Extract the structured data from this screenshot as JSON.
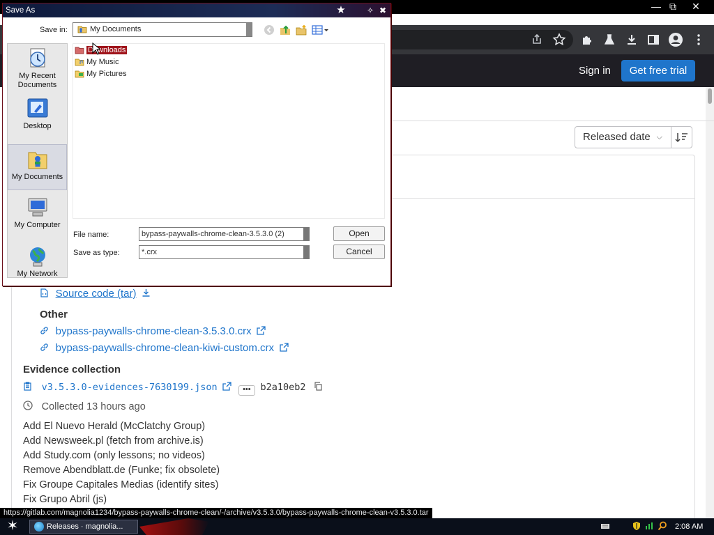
{
  "browser": {
    "window_controls": {
      "minimize": "—",
      "restore": "⧉",
      "close": "✕"
    },
    "toolbar_icons": [
      "share-icon",
      "star-icon",
      "extensions-icon",
      "labs-icon",
      "download-icon",
      "sidepanel-icon",
      "profile-icon",
      "menu-icon"
    ],
    "status_url": "https://gitlab.com/magnolia1234/bypass-paywalls-chrome-clean/-/archive/v3.5.3.0/bypass-paywalls-chrome-clean-v3.5.3.0.tar"
  },
  "gitlab": {
    "header": {
      "sign_in": "Sign in",
      "free_trial": "Get free trial"
    },
    "sort": {
      "label": "Released date"
    },
    "assets": {
      "source_tar": "Source code (tar)",
      "other_heading": "Other",
      "other_links": [
        "bypass-paywalls-chrome-clean-3.5.3.0.crx",
        "bypass-paywalls-chrome-clean-kiwi-custom.crx"
      ]
    },
    "evidence": {
      "heading": "Evidence collection",
      "file": "v3.5.3.0-evidences-7630199.json",
      "sha": "b2a10eb2",
      "collected": "Collected 13 hours ago"
    },
    "notes": [
      "Add El Nuevo Herald (McClatchy Group)",
      "Add Newsweek.pl (fetch from archive.is)",
      "Add Study.com (only lessons; no videos)",
      "Remove Abendblatt.de (Funke; fix obsolete)",
      "Fix Groupe Capitales Medias (identify sites)",
      "Fix Grupo Abril (js)"
    ]
  },
  "dialog": {
    "title": "Save As",
    "save_in_label": "Save in:",
    "save_in_value": "My Documents",
    "places": [
      "My Recent Documents",
      "Desktop",
      "My Documents",
      "My Computer",
      "My Network"
    ],
    "files": [
      "Downloads",
      "My Music",
      "My Pictures"
    ],
    "file_name_label": "File name:",
    "file_name_value": "bypass-paywalls-chrome-clean-3.5.3.0 (2)",
    "save_type_label": "Save as type:",
    "save_type_value": "*.crx",
    "open_button": "Open",
    "cancel_button": "Cancel"
  },
  "taskbar": {
    "task": "Releases · magnolia...",
    "clock": "2:08 AM"
  }
}
